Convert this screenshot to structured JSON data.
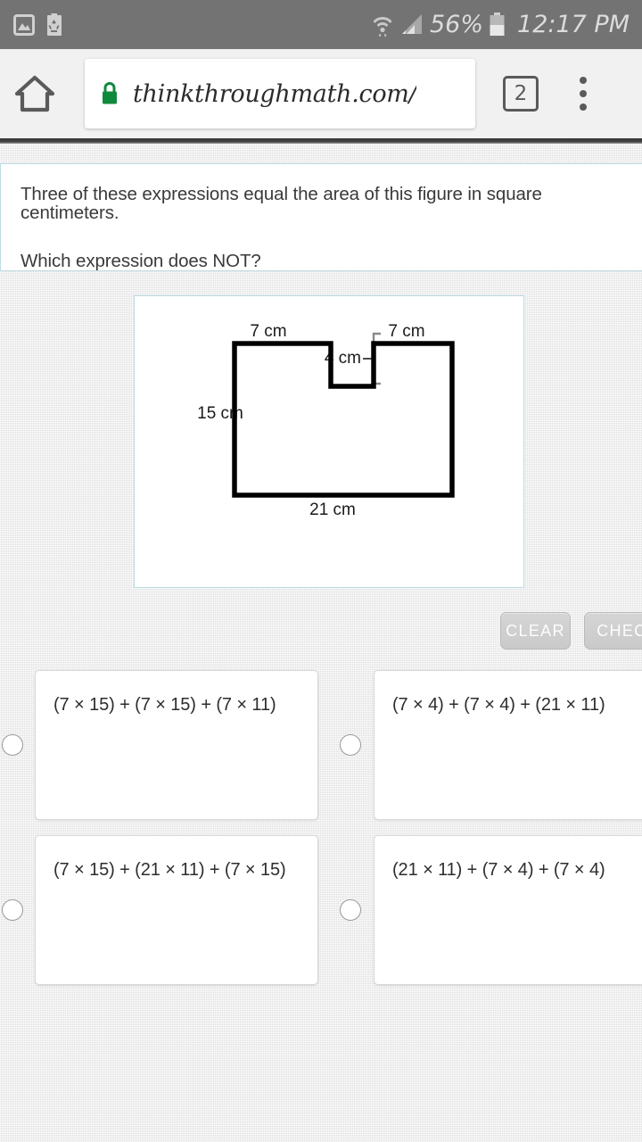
{
  "status_bar": {
    "icons": [
      "image-icon",
      "battery-saver-icon"
    ],
    "wifi_icon": "wifi-icon",
    "signal_icon": "cellular-signal-icon",
    "battery_percent": "56%",
    "battery_icon": "battery-icon",
    "time": "12:17 PM"
  },
  "browser": {
    "home_icon": "home-icon",
    "lock_icon": "lock-icon",
    "lock_color": "#0f8a3d",
    "url": "thinkthroughmath.com/",
    "tab_count": "2",
    "menu_icon": "overflow-menu-icon"
  },
  "question": {
    "line1": "Three of these expressions equal the area of this figure in square centimeters.",
    "line2": "Which expression does NOT?"
  },
  "figure": {
    "labels": {
      "top_left": "7 cm",
      "top_right": "7 cm",
      "notch_depth": "4 cm",
      "left_height": "15 cm",
      "bottom_width": "21 cm"
    },
    "stroke_color": "#000000",
    "panel_border_color": "#bcdde3"
  },
  "toolbar": {
    "clear_label": "CLEAR",
    "check_label": "CHECK"
  },
  "options": [
    {
      "id": "a",
      "text": "(7 × 15) + (7 × 15) + (7 × 11)",
      "selected": false
    },
    {
      "id": "b",
      "text": "(7 × 4) + (7 × 4) + (21 × 11)",
      "selected": false
    },
    {
      "id": "c",
      "text": "(7 × 15) + (21 × 11) + (7 × 15)",
      "selected": false
    },
    {
      "id": "d",
      "text": "(21 × 11) + (7 × 4) + (7 × 4)",
      "selected": false
    }
  ]
}
